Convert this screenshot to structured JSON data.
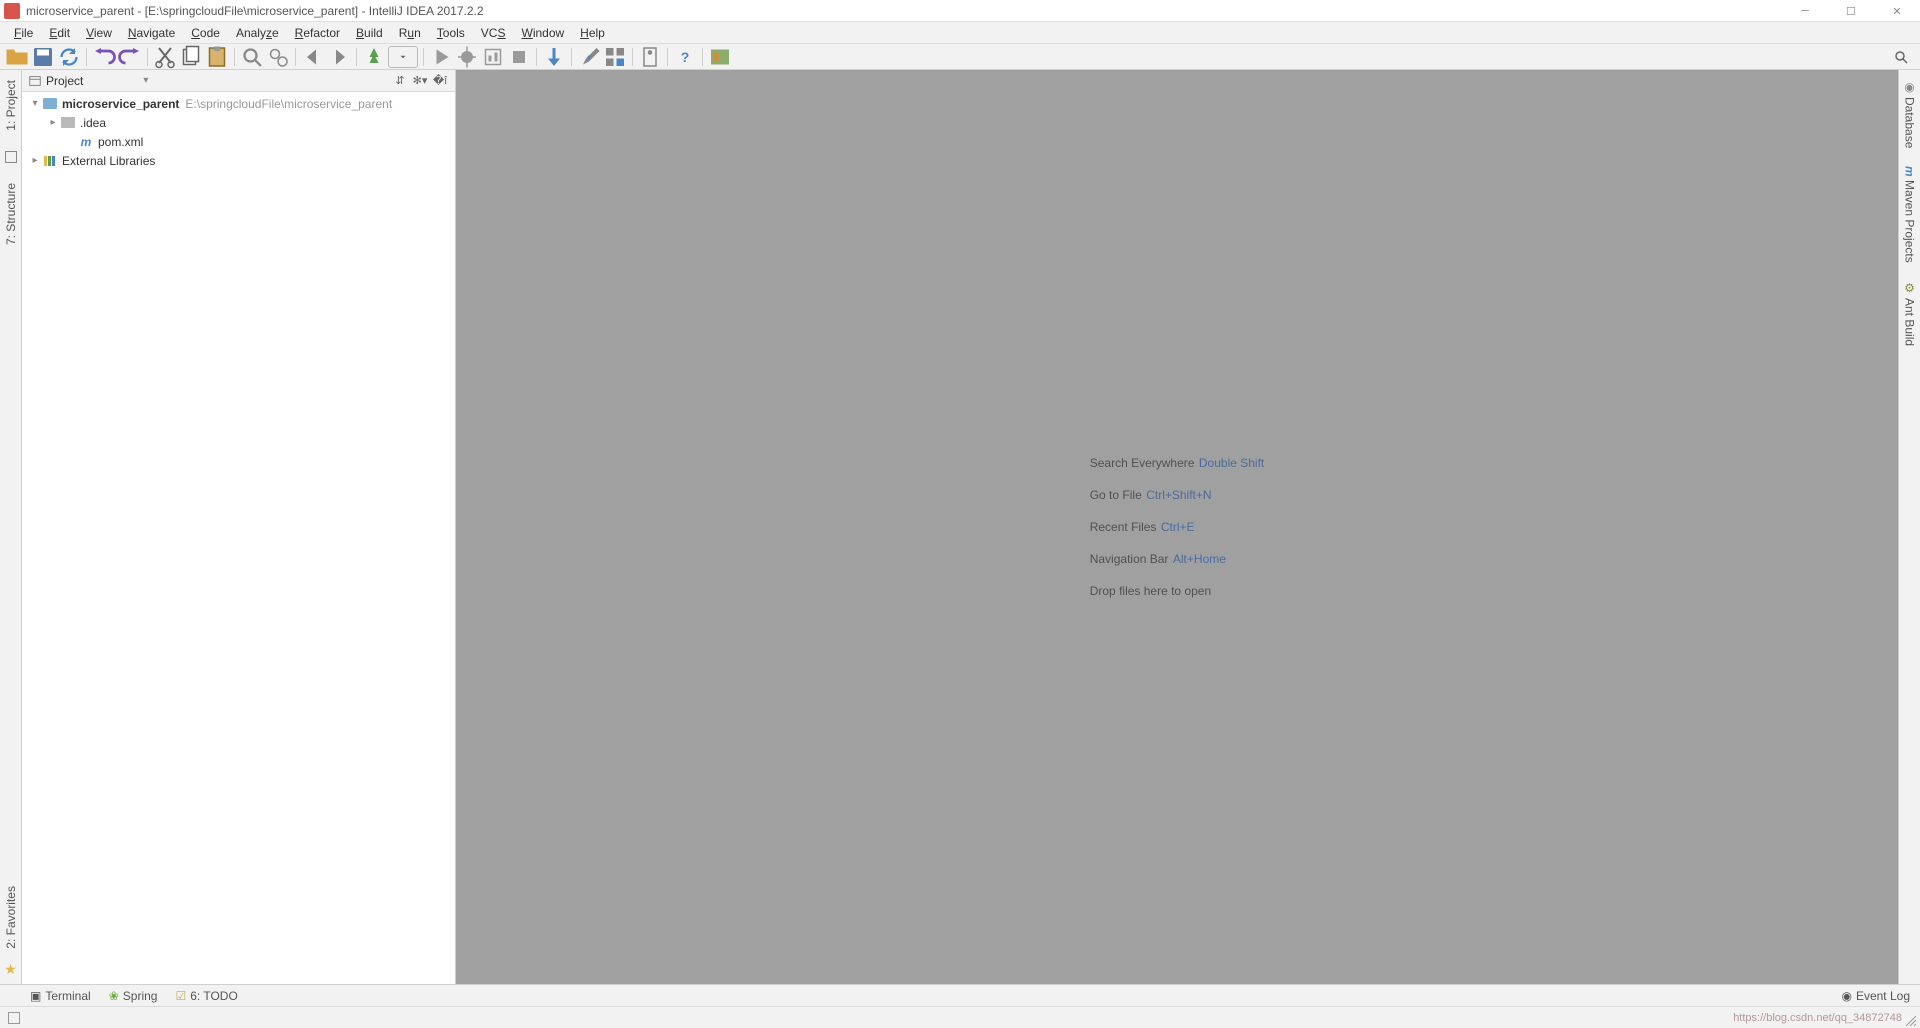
{
  "title": "microservice_parent - [E:\\springcloudFile\\microservice_parent] - IntelliJ IDEA 2017.2.2",
  "menu": [
    "File",
    "Edit",
    "View",
    "Navigate",
    "Code",
    "Analyze",
    "Refactor",
    "Build",
    "Run",
    "Tools",
    "VCS",
    "Window",
    "Help"
  ],
  "project_panel": {
    "label": "Project",
    "root": {
      "name": "microservice_parent",
      "path": "E:\\springcloudFile\\microservice_parent"
    },
    "children": [
      {
        "name": ".idea",
        "type": "folder"
      },
      {
        "name": "pom.xml",
        "type": "maven"
      }
    ],
    "external_libs": "External Libraries"
  },
  "left_tabs": [
    "1: Project",
    "7: Structure",
    "2: Favorites"
  ],
  "right_tabs": [
    "Database",
    "Maven Projects",
    "Ant Build"
  ],
  "welcome": {
    "lines": [
      {
        "text": "Search Everywhere",
        "shortcut": "Double Shift"
      },
      {
        "text": "Go to File",
        "shortcut": "Ctrl+Shift+N"
      },
      {
        "text": "Recent Files",
        "shortcut": "Ctrl+E"
      },
      {
        "text": "Navigation Bar",
        "shortcut": "Alt+Home"
      },
      {
        "text": "Drop files here to open",
        "shortcut": ""
      }
    ]
  },
  "bottom_tabs": [
    {
      "label": "Terminal"
    },
    {
      "label": "Spring"
    },
    {
      "label": "6: TODO"
    }
  ],
  "event_log": "Event Log",
  "watermark": "https://blog.csdn.net/qq_34872748"
}
